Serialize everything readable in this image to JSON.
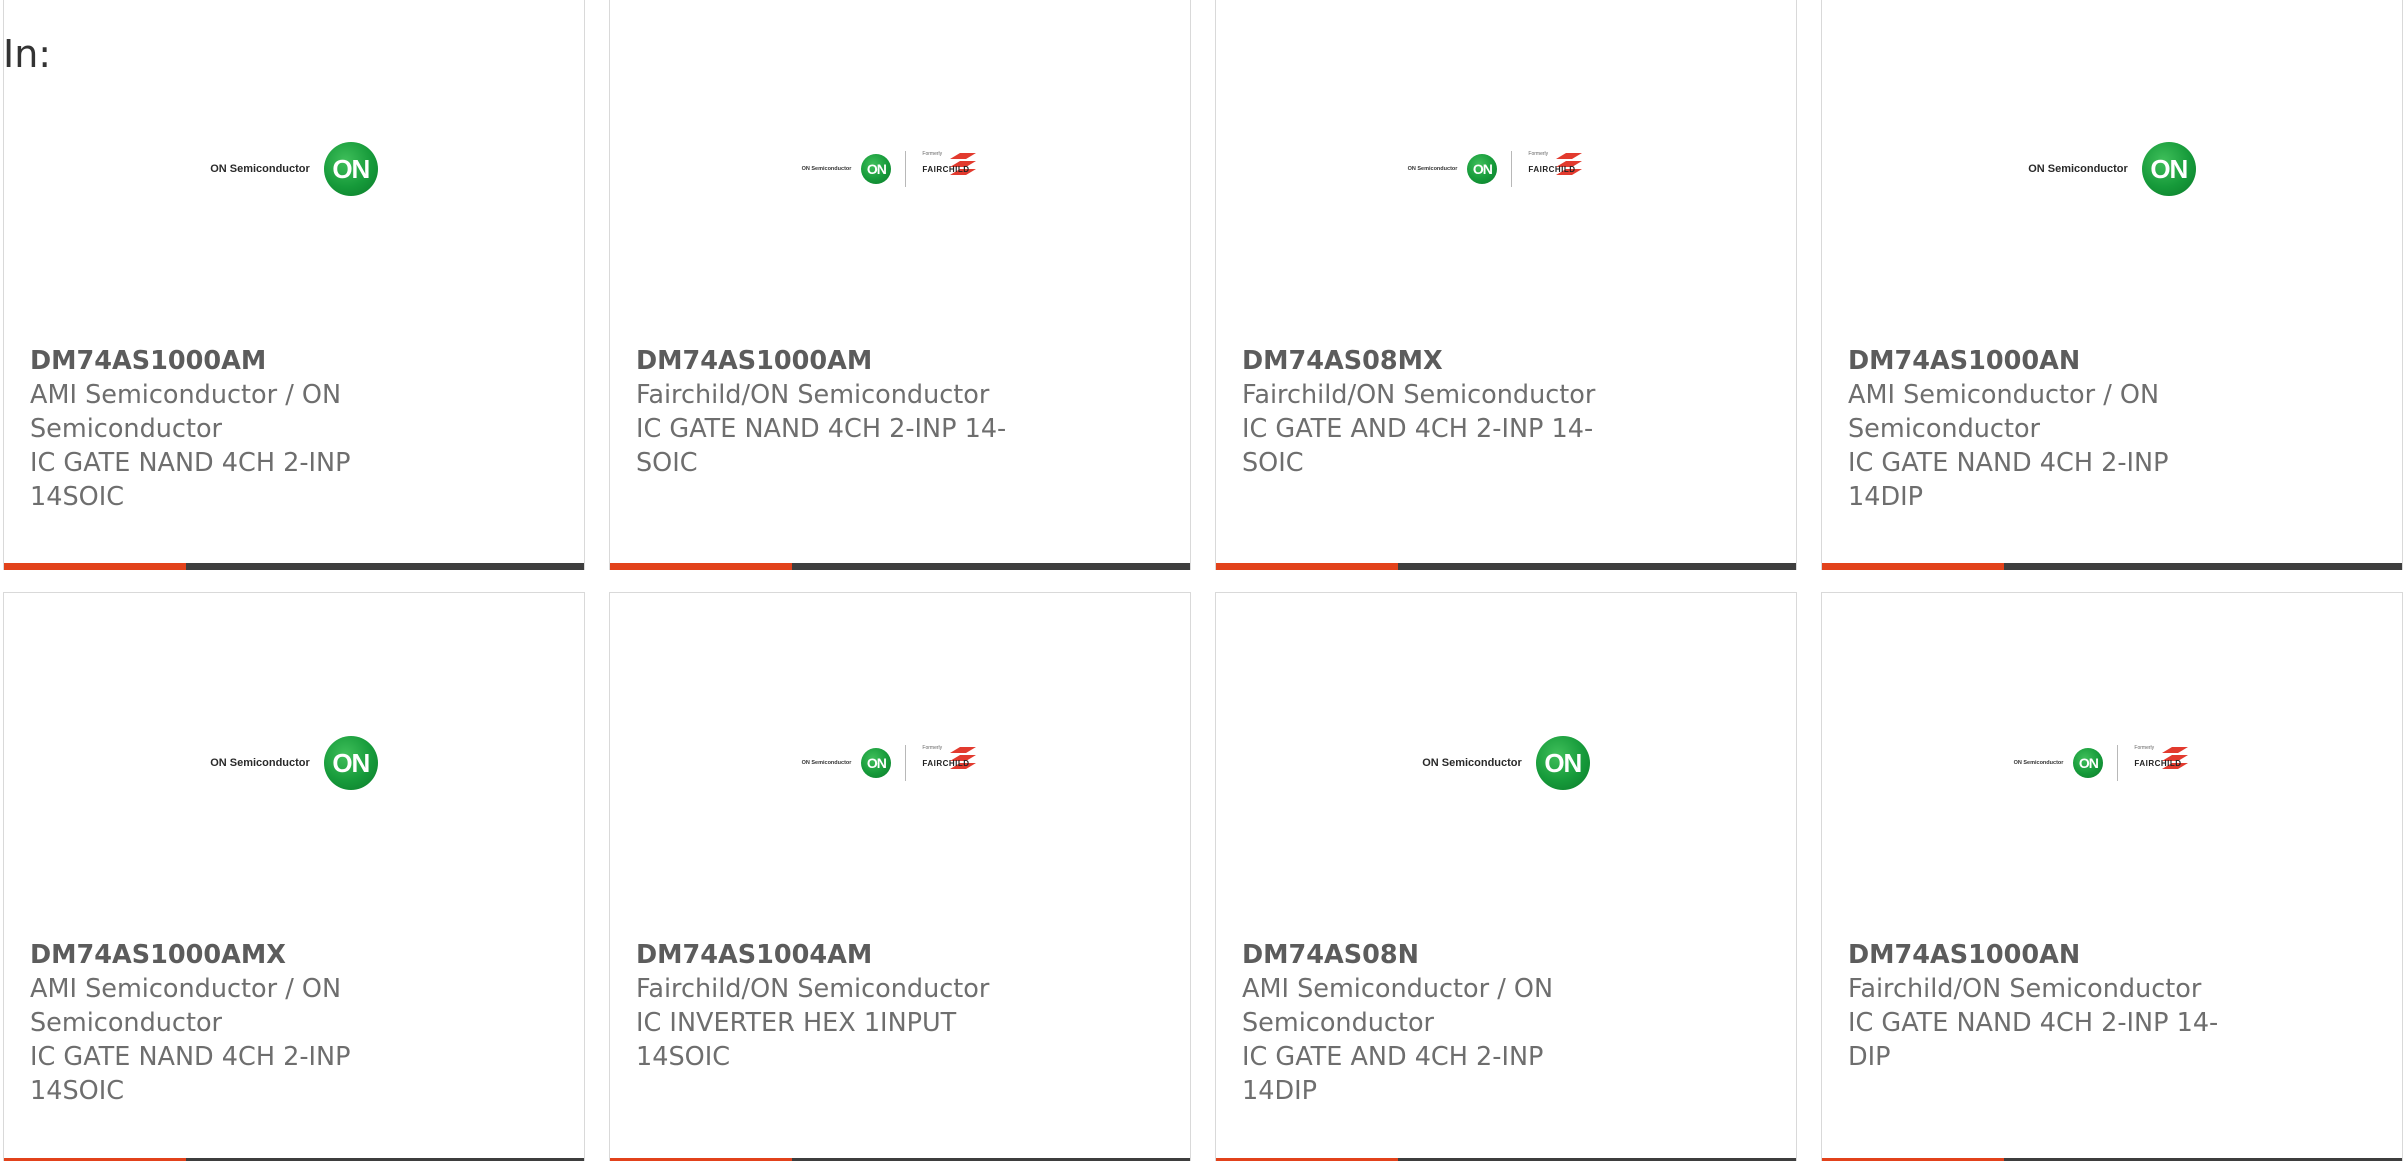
{
  "heading": "In:",
  "logo_text": {
    "on_semiconductor": "ON Semiconductor",
    "on_badge": "ON",
    "formerly": "Formerly",
    "fairchild": "FAIRCHILD"
  },
  "colors": {
    "accent": "#e2421b",
    "bar": "#3e3e3e",
    "on_green": "#169a3a"
  },
  "products": [
    {
      "part": "DM74AS1000AM",
      "manufacturer_lines": [
        "AMI Semiconductor / ON",
        "Semiconductor"
      ],
      "description_lines": [
        "IC GATE NAND 4CH 2-INP",
        "14SOIC"
      ],
      "logo": "on-semiconductor-logo"
    },
    {
      "part": "DM74AS1000AM",
      "manufacturer_lines": [
        "Fairchild/ON Semiconductor"
      ],
      "description_lines": [
        "IC GATE NAND 4CH 2-INP 14-",
        "SOIC"
      ],
      "logo": "on-fairchild-logo"
    },
    {
      "part": "DM74AS08MX",
      "manufacturer_lines": [
        "Fairchild/ON Semiconductor"
      ],
      "description_lines": [
        "IC GATE AND 4CH 2-INP 14-SOIC"
      ],
      "logo": "on-fairchild-logo"
    },
    {
      "part": "DM74AS1000AN",
      "manufacturer_lines": [
        "AMI Semiconductor / ON",
        "Semiconductor"
      ],
      "description_lines": [
        "IC GATE NAND 4CH 2-INP 14DIP"
      ],
      "logo": "on-semiconductor-logo"
    },
    {
      "part": "DM74AS1000AMX",
      "manufacturer_lines": [
        "AMI Semiconductor / ON",
        "Semiconductor"
      ],
      "description_lines": [
        "IC GATE NAND 4CH 2-INP",
        "14SOIC"
      ],
      "logo": "on-semiconductor-logo"
    },
    {
      "part": "DM74AS1004AM",
      "manufacturer_lines": [
        "Fairchild/ON Semiconductor"
      ],
      "description_lines": [
        "IC INVERTER HEX 1INPUT",
        "14SOIC"
      ],
      "logo": "on-fairchild-logo"
    },
    {
      "part": "DM74AS08N",
      "manufacturer_lines": [
        "AMI Semiconductor / ON",
        "Semiconductor"
      ],
      "description_lines": [
        "IC GATE AND 4CH 2-INP 14DIP"
      ],
      "logo": "on-semiconductor-logo"
    },
    {
      "part": "DM74AS1000AN",
      "manufacturer_lines": [
        "Fairchild/ON Semiconductor"
      ],
      "description_lines": [
        "IC GATE NAND 4CH 2-INP 14-DIP"
      ],
      "logo": "on-fairchild-logo"
    }
  ]
}
